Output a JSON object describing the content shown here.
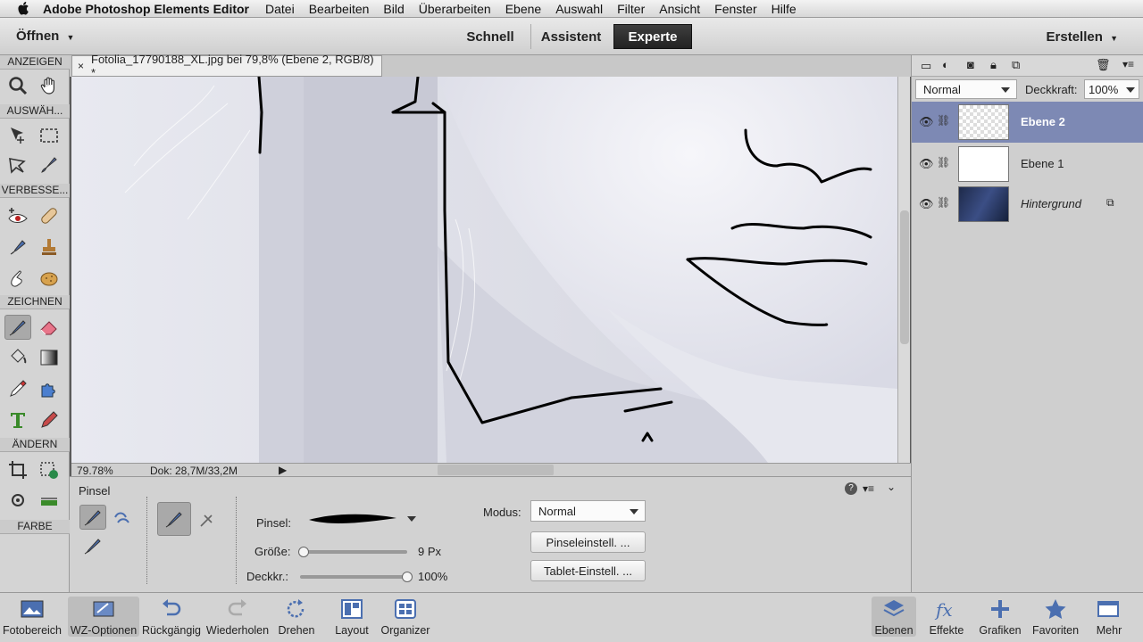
{
  "menubar": {
    "app_name": "Adobe Photoshop Elements Editor",
    "items": [
      "Datei",
      "Bearbeiten",
      "Bild",
      "Überarbeiten",
      "Ebene",
      "Auswahl",
      "Filter",
      "Ansicht",
      "Fenster",
      "Hilfe"
    ]
  },
  "modebar": {
    "open_label": "Öffnen",
    "modes": [
      "Schnell",
      "Assistent",
      "Experte"
    ],
    "active_mode": "Experte",
    "create_label": "Erstellen"
  },
  "toolbox": {
    "sections": [
      "ANZEIGEN",
      "AUSWÄH...",
      "VERBESSE...",
      "ZEICHNEN",
      "ÄNDERN",
      "FARBE"
    ],
    "active_tool": "brush-tool",
    "foreground_color": "#0f1012",
    "background_color": "#ffffff"
  },
  "document": {
    "tab_title": "Fotolia_17790188_XL.jpg bei 79,8% (Ebene 2, RGB/8) *",
    "zoom": "79.78%",
    "doc_size": "Dok: 28,7M/33,2M"
  },
  "tool_options": {
    "tool_name": "Pinsel",
    "brush_label": "Pinsel:",
    "size_label": "Größe:",
    "size_value": "9 Px",
    "size_fraction": 0.03,
    "opacity_label": "Deckkr.:",
    "opacity_value": "100%",
    "opacity_fraction": 1.0,
    "mode_label": "Modus:",
    "mode_value": "Normal",
    "brush_settings_button": "Pinseleinstell. ...",
    "tablet_settings_button": "Tablet-Einstell. ..."
  },
  "layers_panel": {
    "blend_mode": "Normal",
    "opacity_label": "Deckkraft:",
    "opacity_value": "100%",
    "layers": [
      {
        "name": "Ebene 2",
        "selected": true
      },
      {
        "name": "Ebene 1",
        "selected": false
      },
      {
        "name": "Hintergrund",
        "selected": false
      }
    ]
  },
  "bottombar": {
    "left": [
      "Fotobereich",
      "WZ-Optionen",
      "Rückgängig",
      "Wiederholen",
      "Drehen",
      "Layout",
      "Organizer"
    ],
    "right": [
      "Ebenen",
      "Effekte",
      "Grafiken",
      "Favoriten",
      "Mehr"
    ]
  },
  "colors": {
    "accent_selection": "#7d89b4",
    "panel_bg": "#d2d2d2",
    "canvas_tint": "#dfe0ea"
  }
}
